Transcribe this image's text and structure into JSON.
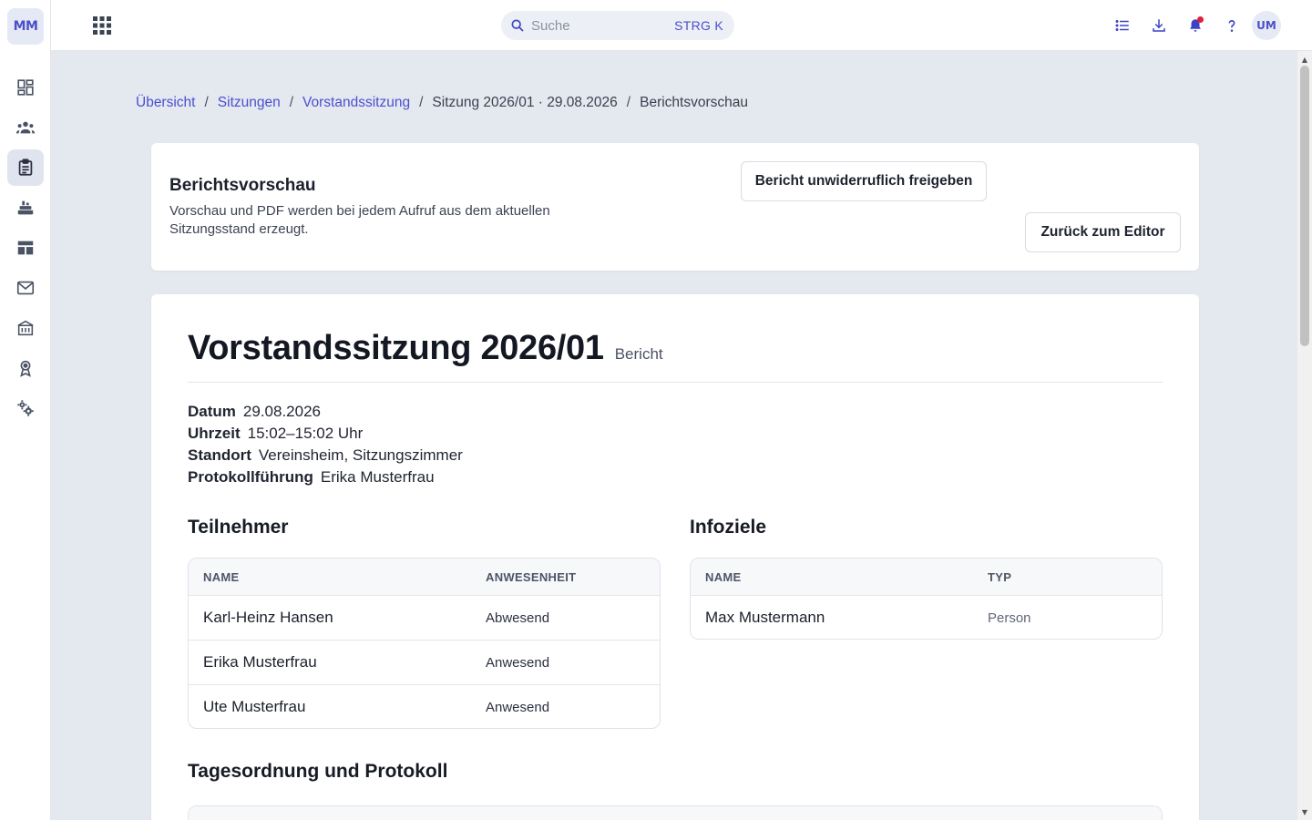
{
  "app": {
    "logo_text": "MM"
  },
  "sidebar": {
    "items": [
      {
        "name": "dashboard",
        "icon": "dashboard-icon",
        "active": false
      },
      {
        "name": "members",
        "icon": "group-icon",
        "active": false
      },
      {
        "name": "meetings",
        "icon": "clipboard-icon",
        "active": true
      },
      {
        "name": "events",
        "icon": "event-icon",
        "active": false
      },
      {
        "name": "tables",
        "icon": "table-icon",
        "active": false
      },
      {
        "name": "mail",
        "icon": "mail-icon",
        "active": false
      },
      {
        "name": "organization",
        "icon": "building-icon",
        "active": false
      },
      {
        "name": "awards",
        "icon": "medal-icon",
        "active": false
      },
      {
        "name": "settings",
        "icon": "gears-icon",
        "active": false
      }
    ]
  },
  "topbar": {
    "search": {
      "placeholder": "Suche",
      "shortcut": "STRG K"
    },
    "avatar_initials": "UM",
    "icons": [
      "list-icon",
      "download-icon",
      "bell-icon",
      "help-icon"
    ]
  },
  "breadcrumb": {
    "items": [
      {
        "label": "Übersicht",
        "link": true
      },
      {
        "label": "Sitzungen",
        "link": true
      },
      {
        "label": "Vorstandssitzung",
        "link": true
      },
      {
        "label": "Sitzung 2026/01 · 29.08.2026",
        "link": false
      },
      {
        "label": "Berichtsvorschau",
        "link": false
      }
    ],
    "separator": "/"
  },
  "header": {
    "title": "Berichtsvorschau",
    "description": "Vorschau und PDF werden bei jedem Aufruf aus dem aktuellen Sitzungsstand erzeugt.",
    "release_button": "Bericht unwiderruflich freigeben",
    "back_button": "Zurück zum Editor"
  },
  "report": {
    "title": "Vorstandssitzung 2026/01",
    "subtitle": "Bericht",
    "meta": [
      {
        "label": "Datum",
        "value": "29.08.2026"
      },
      {
        "label": "Uhrzeit",
        "value": "15:02–15:02 Uhr"
      },
      {
        "label": "Standort",
        "value": "Vereinsheim, Sitzungszimmer"
      },
      {
        "label": "Protokollführung",
        "value": "Erika Musterfrau"
      }
    ],
    "participants": {
      "title": "Teilnehmer",
      "columns": [
        "NAME",
        "ANWESENHEIT"
      ],
      "rows": [
        {
          "name": "Karl-Heinz Hansen",
          "status": "Abwesend"
        },
        {
          "name": "Erika Musterfrau",
          "status": "Anwesend"
        },
        {
          "name": "Ute Musterfrau",
          "status": "Anwesend"
        }
      ]
    },
    "info_targets": {
      "title": "Infoziele",
      "columns": [
        "NAME",
        "TYP"
      ],
      "rows": [
        {
          "name": "Max Mustermann",
          "type": "Person"
        }
      ]
    },
    "agenda": {
      "title": "Tagesordnung und Protokoll"
    }
  }
}
